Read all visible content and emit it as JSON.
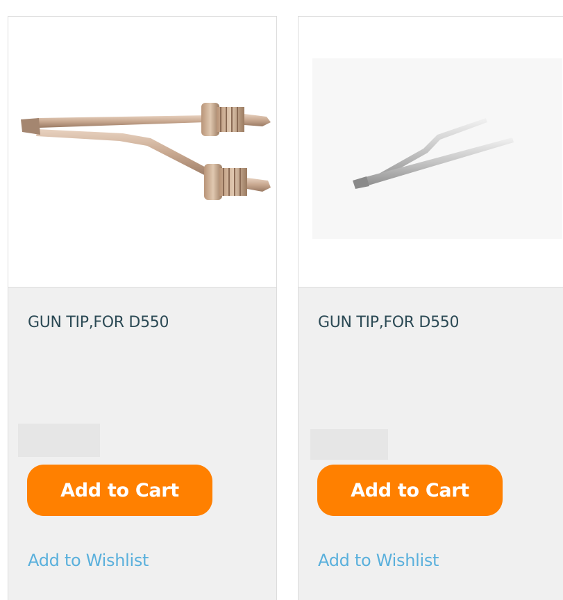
{
  "products": [
    {
      "title": "GUN TIP,FOR D550",
      "image_icon": "solder-gun-tip-image",
      "cart_label": "Add to Cart",
      "wishlist_label": "Add to Wishlist"
    },
    {
      "title": "GUN TIP,FOR D550",
      "image_icon": "solder-gun-tip-image",
      "cart_label": "Add to Cart",
      "wishlist_label": "Add to Wishlist"
    }
  ],
  "colors": {
    "accent": "#ff8000",
    "link": "#5ab0dc",
    "title": "#2c4a55",
    "card_info_bg": "#f0f0f0"
  }
}
